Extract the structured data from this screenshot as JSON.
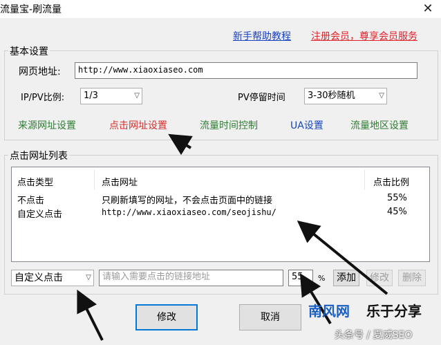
{
  "window": {
    "title": "流量宝-刷流量",
    "close_glyph": "✕"
  },
  "header_links": {
    "tutorial": "新手帮助教程",
    "register": "注册会员，尊享会员服务"
  },
  "basic_settings": {
    "group_title": "基本设置",
    "url_label": "网页地址:",
    "url_value": "http://www.xiaoxiaseo.com",
    "ip_pv_label": "IP/PV比例:",
    "ip_pv_value": "1/3",
    "pv_stay_label": "PV停留时间",
    "pv_stay_value": "3-30秒随机",
    "tabs": [
      {
        "label": "来源网址设置",
        "color": "#2e7d32"
      },
      {
        "label": "点击网址设置",
        "color": "#d32f2f"
      },
      {
        "label": "流量时间控制",
        "color": "#2e7d32"
      },
      {
        "label": "UA设置",
        "color": "#1a47b8"
      },
      {
        "label": "流量地区设置",
        "color": "#2e7d32"
      }
    ]
  },
  "click_list": {
    "group_title": "点击网址列表",
    "columns": [
      "点击类型",
      "点击网址",
      "点击比例"
    ],
    "rows": [
      {
        "type": "不点击",
        "url": "只刷新填写的网址，不会点击页面中的链接",
        "ratio": "55%"
      },
      {
        "type": "自定义点击",
        "url": "http://www.xiaoxiaseo.com/seojishu/",
        "ratio": "45%"
      }
    ],
    "mode_value": "自定义点击",
    "link_placeholder": "请输入需要点击的链接地址",
    "ratio_value": "55",
    "percent_sign": "%",
    "add_label": "添加",
    "edit_label": "修改",
    "delete_label": "删除"
  },
  "footer": {
    "modify_label": "修改",
    "cancel_label": "取消"
  },
  "watermark": {
    "brand": "南风网",
    "slogan": "乐于分享",
    "sub": "头条号 / 夏威SEO"
  },
  "colors": {
    "link_blue": "#1a3fbf",
    "register_red": "#e0202a",
    "focus_blue": "#0078d7"
  }
}
